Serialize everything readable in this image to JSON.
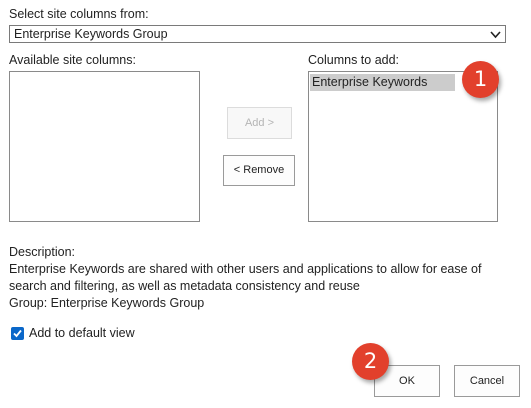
{
  "select_columns": {
    "label": "Select site columns from:",
    "selected": "Enterprise Keywords Group"
  },
  "available": {
    "label": "Available site columns:",
    "items": []
  },
  "to_add": {
    "label": "Columns to add:",
    "items": [
      "Enterprise Keywords"
    ]
  },
  "buttons": {
    "add": "Add >",
    "remove": "< Remove",
    "ok": "OK",
    "cancel": "Cancel"
  },
  "description": {
    "label": "Description:",
    "text": "Enterprise Keywords are shared with other users and applications to allow for ease of search and filtering, as well as metadata consistency and reuse"
  },
  "group": "Group: Enterprise Keywords Group",
  "default_view": {
    "label": "Add to default view",
    "checked": true
  },
  "markers": {
    "one": "1",
    "two": "2",
    "color": "#e2402c"
  },
  "colors": {
    "checkbox": "#0a67c9",
    "selected_item": "#cccccc"
  }
}
